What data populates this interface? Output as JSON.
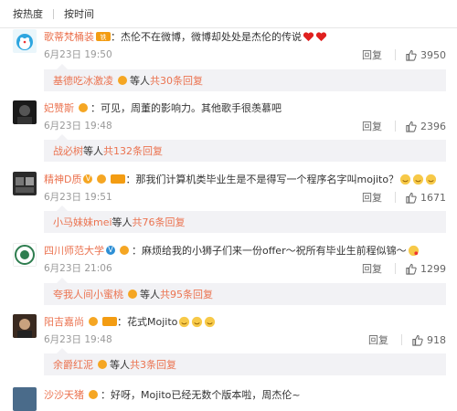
{
  "sort": {
    "hot": "按热度",
    "time": "按时间"
  },
  "comments": [
    {
      "user": "歌蒂梵桶装",
      "text": "：杰伦不在微博，微博却处处是杰伦的传说",
      "time": "6月23日 19:50",
      "reply": "回复",
      "likes": "3950",
      "sub": {
        "user": "基德吃冰激凌",
        "mid": " 等人 ",
        "total": "共30条回复"
      }
    },
    {
      "user": "妃赞斯",
      "text": "：可见，周董的影响力。其他歌手很羡慕吧",
      "time": "6月23日 19:48",
      "reply": "回复",
      "likes": "2396",
      "sub": {
        "user": "战必树",
        "mid": " 等人 ",
        "total": "共132条回复"
      }
    },
    {
      "user": "精神D质",
      "text": "：那我们计算机类毕业生是不是得写一个程序名字叫mojito？",
      "time": "6月23日 19:51",
      "reply": "回复",
      "likes": "1671",
      "sub": {
        "user": "小马妹妹mei",
        "mid": " 等人 ",
        "total": "共76条回复"
      }
    },
    {
      "user": "四川师范大学",
      "text": "：麻烦给我的小狮子们来一份offer～祝所有毕业生前程似锦～",
      "time": "6月23日 21:06",
      "reply": "回复",
      "likes": "1299",
      "sub": {
        "user": "夸我人间小蜜桃",
        "mid": " 等人 ",
        "total": "共95条回复"
      }
    },
    {
      "user": "阳吉嘉尚",
      "text": "：花式Mojito",
      "time": "6月23日 19:48",
      "reply": "回复",
      "likes": "918",
      "sub": {
        "user": "余爵红泥",
        "mid": " 等人 ",
        "total": "共3条回复"
      }
    },
    {
      "user": "沙沙天猪",
      "text": "：好呀，Mojito已经无数个版本啦，周杰伦~"
    }
  ],
  "colors": {
    "accent": "#eb7350",
    "meta": "#999999",
    "subbg": "#f2f2f5"
  }
}
